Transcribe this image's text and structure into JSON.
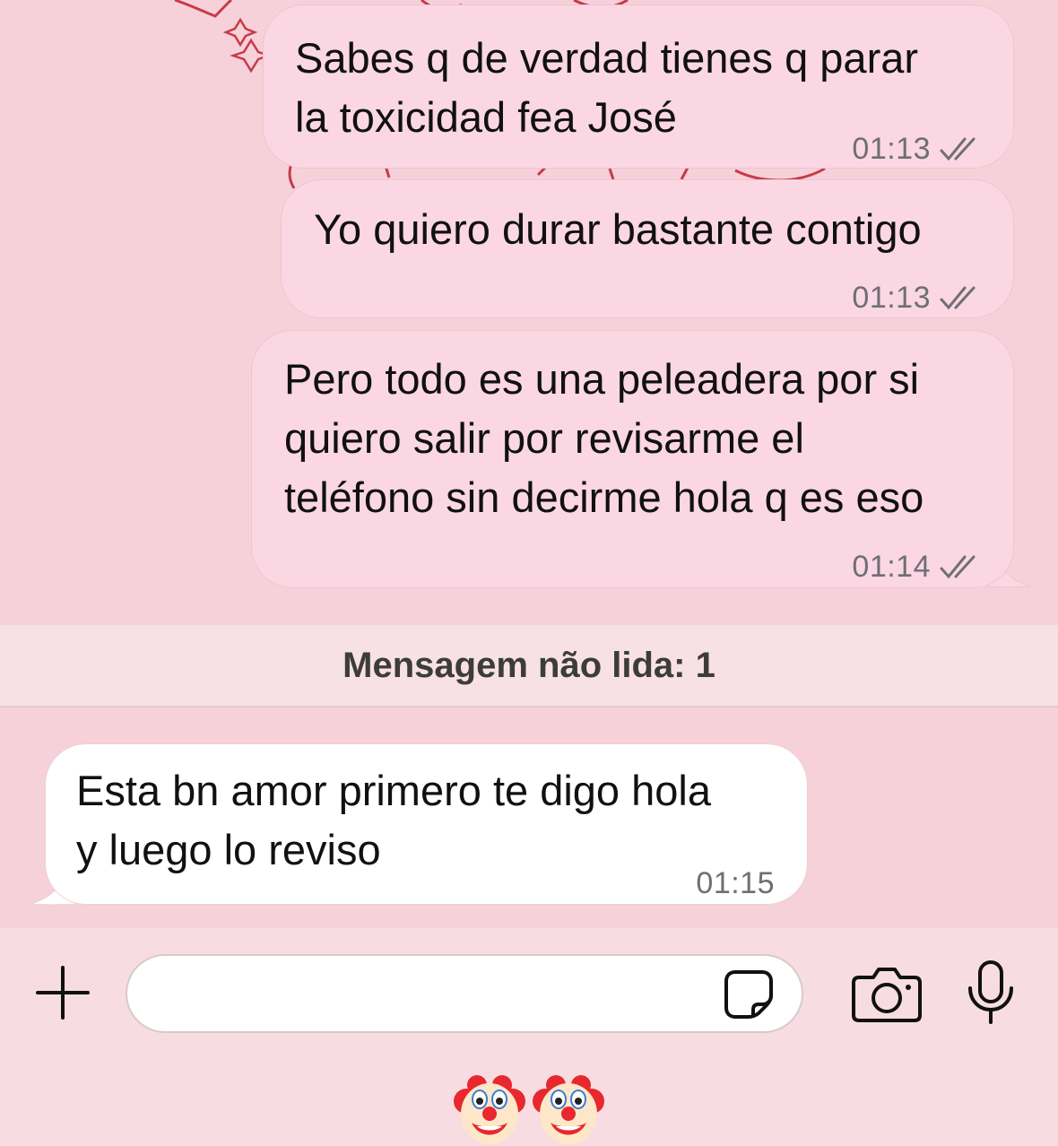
{
  "messages": [
    {
      "direction": "outgoing",
      "text": "Sabes q de verdad tienes q parar\nla toxicidad fea José",
      "time": "01:13",
      "status": "read-double-check"
    },
    {
      "direction": "outgoing",
      "text": "Yo quiero durar bastante contigo",
      "time": "01:13",
      "status": "read-double-check"
    },
    {
      "direction": "outgoing",
      "text": "Pero todo es una peleadera por si\nquiero salir por revisarme el\nteléfono sin decirme hola q es eso",
      "time": "01:14",
      "status": "read-double-check"
    },
    {
      "direction": "incoming",
      "text": "Esta bn amor primero te digo hola\ny luego lo reviso",
      "time": "01:15"
    }
  ],
  "unread_banner": "Mensagem não lida: 1",
  "input": {
    "value": "",
    "placeholder": ""
  },
  "icons": {
    "attach": "plus-icon",
    "sticker": "sticker-icon",
    "camera": "camera-icon",
    "mic": "microphone-icon",
    "tick": "double-check-icon",
    "emoji": "clown-face-emoji"
  },
  "emoji_row": [
    "🤡",
    "🤡"
  ],
  "colors": {
    "chat_background": "#f7d1d9",
    "outgoing_bubble": "#fbd7e4",
    "incoming_bubble": "#ffffff",
    "unread_banner": "#f8e1e5",
    "input_bar": "#f7dde1"
  }
}
